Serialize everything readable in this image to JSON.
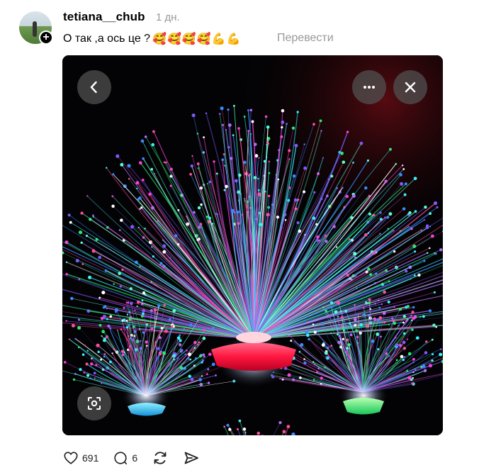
{
  "post": {
    "username": "tetiana__chub",
    "time": "1 дн.",
    "caption_text": "О так ,а ось це ?",
    "caption_emojis": "🥰🥰🥰🥰💪💪",
    "translate_label": "Перевести"
  },
  "media": {
    "description_icon": "fiber-optic-lamp-photo"
  },
  "actions": {
    "like_count": "691",
    "comment_count": "6"
  },
  "icons": {
    "back": "chevron-left-icon",
    "more": "more-icon",
    "close": "close-icon",
    "lens": "lens-icon",
    "like": "heart-icon",
    "comment": "comment-icon",
    "repost": "repost-icon",
    "share": "share-icon"
  }
}
